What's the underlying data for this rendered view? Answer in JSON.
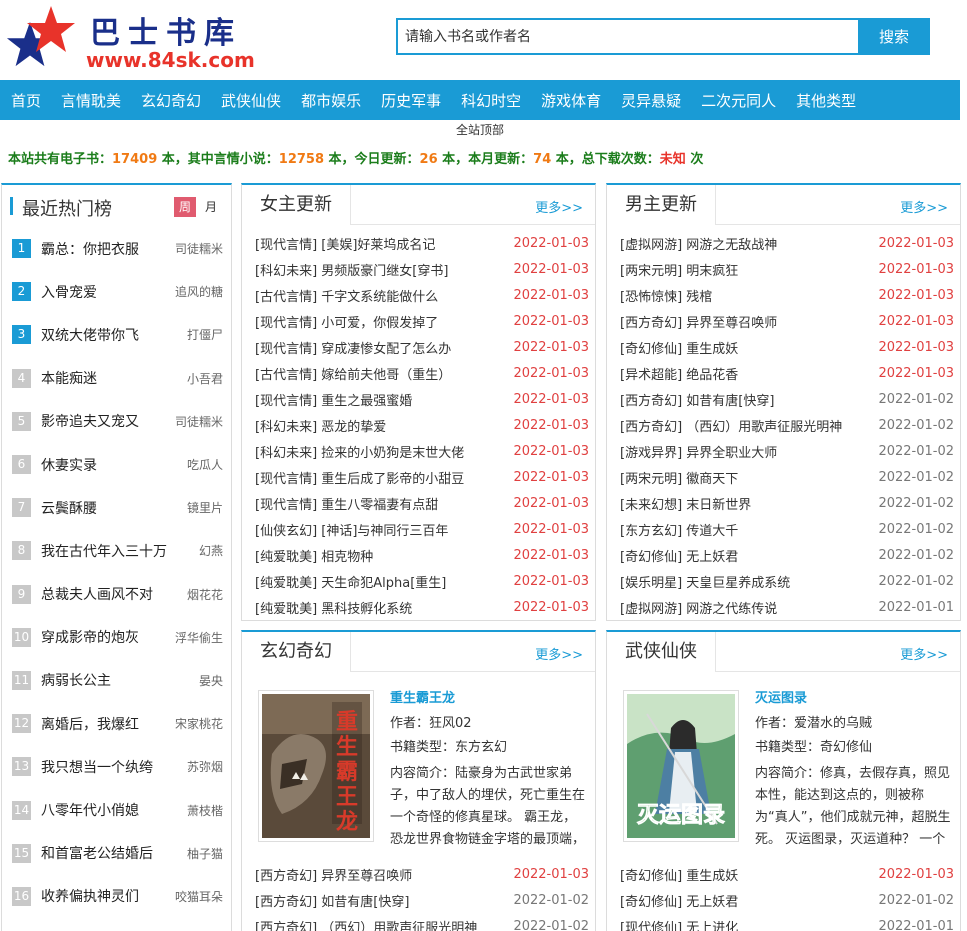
{
  "site": {
    "title": "巴士书库",
    "url": "www.84sk.com"
  },
  "search": {
    "placeholder": "请输入书名或作者名",
    "button": "搜索"
  },
  "nav": [
    "首页",
    "言情耽美",
    "玄幻奇幻",
    "武侠仙侠",
    "都市娱乐",
    "历史军事",
    "科幻时空",
    "游戏体育",
    "灵异悬疑",
    "二次元同人",
    "其他类型"
  ],
  "nav_sub": "全站顶部",
  "stats": {
    "p1": "本站共有电子书：",
    "total": "17409",
    "p2": " 本，其中言情小说：",
    "romance": "12758",
    "p3": " 本，今日更新：",
    "today": "26",
    "p4": " 本，本月更新：",
    "month": "74",
    "p5": " 本，总下载次数：",
    "downloads": "未知",
    "p6": " 次"
  },
  "rank": {
    "title": "最近热门榜",
    "tab_week": "周",
    "tab_month": "月",
    "items": [
      {
        "n": "1",
        "name": "霸总：你把衣服",
        "author": "司徒糯米"
      },
      {
        "n": "2",
        "name": "入骨宠爱",
        "author": "追风的糖"
      },
      {
        "n": "3",
        "name": "双统大佬带你飞",
        "author": "打僵尸"
      },
      {
        "n": "4",
        "name": "本能痴迷",
        "author": "小吾君"
      },
      {
        "n": "5",
        "name": "影帝追夫又宠又",
        "author": "司徒糯米"
      },
      {
        "n": "6",
        "name": "休妻实录",
        "author": "吃瓜人"
      },
      {
        "n": "7",
        "name": "云鬓酥腰",
        "author": "镜里片"
      },
      {
        "n": "8",
        "name": "我在古代年入三十万",
        "author": "幻燕"
      },
      {
        "n": "9",
        "name": "总裁夫人画风不对",
        "author": "烟花花"
      },
      {
        "n": "10",
        "name": "穿成影帝的炮灰",
        "author": "浮华偷生"
      },
      {
        "n": "11",
        "name": "病弱长公主",
        "author": "晏央"
      },
      {
        "n": "12",
        "name": "离婚后，我爆红",
        "author": "宋家桃花"
      },
      {
        "n": "13",
        "name": "我只想当一个纨绔",
        "author": "苏弥烟"
      },
      {
        "n": "14",
        "name": "八零年代小俏媳",
        "author": "萧枝楷"
      },
      {
        "n": "15",
        "name": "和首富老公结婚后",
        "author": "柚子猫"
      },
      {
        "n": "16",
        "name": "收养偏执神灵们",
        "author": "咬猫耳朵"
      }
    ]
  },
  "female": {
    "title": "女主更新",
    "more": "更多>>",
    "rows": [
      {
        "t": "[现代言情] [美娱]好莱坞成名记",
        "d": "2022-01-03"
      },
      {
        "t": "[科幻未来] 男频版豪门继女[穿书]",
        "d": "2022-01-03"
      },
      {
        "t": "[古代言情] 千字文系统能做什么",
        "d": "2022-01-03"
      },
      {
        "t": "[现代言情] 小可爱，你假发掉了",
        "d": "2022-01-03"
      },
      {
        "t": "[现代言情] 穿成凄惨女配了怎么办",
        "d": "2022-01-03"
      },
      {
        "t": "[古代言情] 嫁给前夫他哥（重生）",
        "d": "2022-01-03"
      },
      {
        "t": "[现代言情] 重生之最强蜜婚",
        "d": "2022-01-03"
      },
      {
        "t": "[科幻未来] 恶龙的挚爱",
        "d": "2022-01-03"
      },
      {
        "t": "[科幻未来] 捡来的小奶狗是末世大佬",
        "d": "2022-01-03"
      },
      {
        "t": "[现代言情] 重生后成了影帝的小甜豆",
        "d": "2022-01-03"
      },
      {
        "t": "[现代言情] 重生八零福妻有点甜",
        "d": "2022-01-03"
      },
      {
        "t": "[仙侠玄幻] [神话]与神同行三百年",
        "d": "2022-01-03"
      },
      {
        "t": "[纯爱耽美] 相克物种",
        "d": "2022-01-03"
      },
      {
        "t": "[纯爱耽美] 天生命犯Alpha[重生]",
        "d": "2022-01-03"
      },
      {
        "t": "[纯爱耽美] 黑科技孵化系统",
        "d": "2022-01-03"
      }
    ]
  },
  "male": {
    "title": "男主更新",
    "more": "更多>>",
    "rows": [
      {
        "t": "[虚拟网游] 网游之无敌战神",
        "d": "2022-01-03"
      },
      {
        "t": "[两宋元明] 明末疯狂",
        "d": "2022-01-03"
      },
      {
        "t": "[恐怖惊悚] 残棺",
        "d": "2022-01-03"
      },
      {
        "t": "[西方奇幻] 异界至尊召唤师",
        "d": "2022-01-03"
      },
      {
        "t": "[奇幻修仙] 重生成妖",
        "d": "2022-01-03"
      },
      {
        "t": "[异术超能] 绝品花香",
        "d": "2022-01-03"
      },
      {
        "t": "[西方奇幻] 如昔有唐[快穿]",
        "d": "2022-01-02"
      },
      {
        "t": "[西方奇幻] （西幻）用歌声征服光明神",
        "d": "2022-01-02"
      },
      {
        "t": "[游戏异界] 异界全职业大师",
        "d": "2022-01-02"
      },
      {
        "t": "[两宋元明] 徽商天下",
        "d": "2022-01-02"
      },
      {
        "t": "[未来幻想] 末日新世界",
        "d": "2022-01-02"
      },
      {
        "t": "[东方玄幻] 传道大千",
        "d": "2022-01-02"
      },
      {
        "t": "[奇幻修仙] 无上妖君",
        "d": "2022-01-02"
      },
      {
        "t": "[娱乐明星] 天皇巨星养成系统",
        "d": "2022-01-02"
      },
      {
        "t": "[虚拟网游] 网游之代练传说",
        "d": "2022-01-01"
      }
    ]
  },
  "xuanhuan": {
    "title": "玄幻奇幻",
    "more": "更多>>",
    "feature": {
      "name": "重生霸王龙",
      "author_label": "作者：",
      "author": "狂风02",
      "type_label": "书籍类型：",
      "type": "东方玄幻",
      "intro_label": "内容简介：",
      "intro": "陆豪身为古武世家弟子，中了敌人的埋伏，死亡重生在一个奇怪的修真星球。 霸王龙，恐龙世界食物链金字塔的最顶端，"
    },
    "rows": [
      {
        "t": "[西方奇幻] 异界至尊召唤师",
        "d": "2022-01-03"
      },
      {
        "t": "[西方奇幻] 如昔有唐[快穿]",
        "d": "2022-01-02"
      },
      {
        "t": "[西方奇幻] （西幻）用歌声征服光明神",
        "d": "2022-01-02"
      }
    ]
  },
  "wuxia": {
    "title": "武侠仙侠",
    "more": "更多>>",
    "feature": {
      "name": "灭运图录",
      "author_label": "作者：",
      "author": "爱潜水的乌贼",
      "type_label": "书籍类型：",
      "type": "奇幻修仙",
      "intro_label": "内容简介：",
      "intro": "修真，去假存真，照见本性，能达到这点的，则被称为“真人”，他们成就元神，超脱生死。 灭运图录，灭运道种？ 一个"
    },
    "rows": [
      {
        "t": "[奇幻修仙] 重生成妖",
        "d": "2022-01-03"
      },
      {
        "t": "[奇幻修仙] 无上妖君",
        "d": "2022-01-02"
      },
      {
        "t": "[现代修仙] 无上进化",
        "d": "2022-01-01"
      }
    ]
  },
  "colors": {
    "accent": "#1a9bd5",
    "date_red": "#e04040",
    "stats_green": "#1b7d1b",
    "stats_orange": "#f07a14"
  }
}
